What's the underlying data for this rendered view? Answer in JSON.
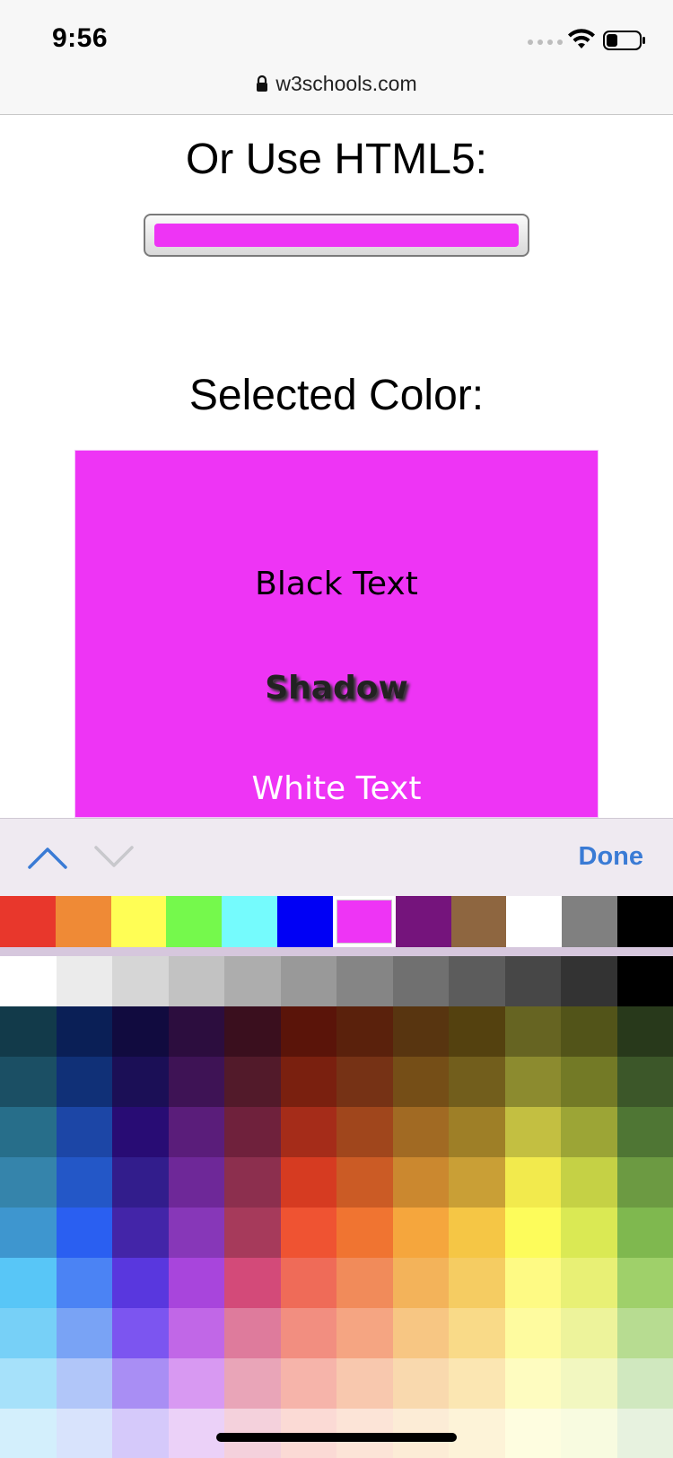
{
  "status_bar": {
    "time": "9:56",
    "url": "w3schools.com"
  },
  "page": {
    "html5_heading": "Or Use HTML5:",
    "selected_heading": "Selected Color:",
    "selected_color": "#ee34f5",
    "preview": {
      "black_text": "Black Text",
      "shadow_text": "Shadow",
      "white_text": "White Text"
    }
  },
  "picker": {
    "done_label": "Done",
    "quick_colors": [
      "#e8372c",
      "#ef8a36",
      "#fffe55",
      "#75f94c",
      "#75fbfd",
      "#0000f5",
      "#ee34f5",
      "#75147c",
      "#8e6640",
      "#ffffff",
      "#808080",
      "#000000"
    ],
    "selected_index": 6,
    "grid": [
      [
        "#ffffff",
        "#ebebeb",
        "#d6d6d6",
        "#c2c2c2",
        "#adadad",
        "#999999",
        "#858585",
        "#707070",
        "#5c5c5c",
        "#474747",
        "#333333",
        "#000000"
      ],
      [
        "#123a4a",
        "#0a1f56",
        "#110b3f",
        "#2c0d3e",
        "#3a0f1e",
        "#5a1409",
        "#5a210c",
        "#583510",
        "#54410f",
        "#666422",
        "#525419",
        "#28391b"
      ],
      [
        "#1b4f64",
        "#103077",
        "#1b0f56",
        "#3e1355",
        "#521a2a",
        "#7a200f",
        "#763215",
        "#754e17",
        "#725e1c",
        "#8c8b2f",
        "#737a26",
        "#3c5729"
      ],
      [
        "#276e8a",
        "#1c46a6",
        "#280c74",
        "#5a1d7a",
        "#6f213c",
        "#a52c19",
        "#a0461c",
        "#a16a23",
        "#9e7f27",
        "#c3bf41",
        "#9ca536",
        "#4f7634"
      ],
      [
        "#3584ab",
        "#2357c7",
        "#321d8c",
        "#6e2898",
        "#8c2f4e",
        "#d63b21",
        "#cb5b25",
        "#cb882f",
        "#c99f36",
        "#f2ea4d",
        "#c5d145",
        "#6c9a42"
      ],
      [
        "#3e96cf",
        "#2a5ff1",
        "#4325a8",
        "#8737b8",
        "#a63a5b",
        "#ef5332",
        "#f07431",
        "#f5a63d",
        "#f5c645",
        "#fdfc5b",
        "#dae954",
        "#7fb84f"
      ],
      [
        "#58c6f7",
        "#4b83f4",
        "#5937de",
        "#a845dc",
        "#d34a79",
        "#ef6b58",
        "#f18b5a",
        "#f3b35a",
        "#f5cc62",
        "#fefa84",
        "#e8f075",
        "#9fd06a"
      ],
      [
        "#77d0f7",
        "#79a3f5",
        "#7c55f0",
        "#c167e7",
        "#de7b9c",
        "#f28e80",
        "#f5a582",
        "#f7c683",
        "#f9da88",
        "#fefb9f",
        "#edf39b",
        "#b7dc91"
      ],
      [
        "#a6e1fa",
        "#b1c6f9",
        "#a98ef4",
        "#d899f2",
        "#e9a5b8",
        "#f6b4aa",
        "#f8c8ae",
        "#f9d9ae",
        "#fbe6b2",
        "#fefcc0",
        "#f2f7c0",
        "#d0e8bf"
      ],
      [
        "#d3effc",
        "#d8e3fc",
        "#d5c9fa",
        "#ebd1f8",
        "#f4d1dc",
        "#fbdad5",
        "#fce4d7",
        "#fcecd6",
        "#fdf3d8",
        "#fefde0",
        "#f8fbe0",
        "#e7f2df"
      ]
    ]
  }
}
